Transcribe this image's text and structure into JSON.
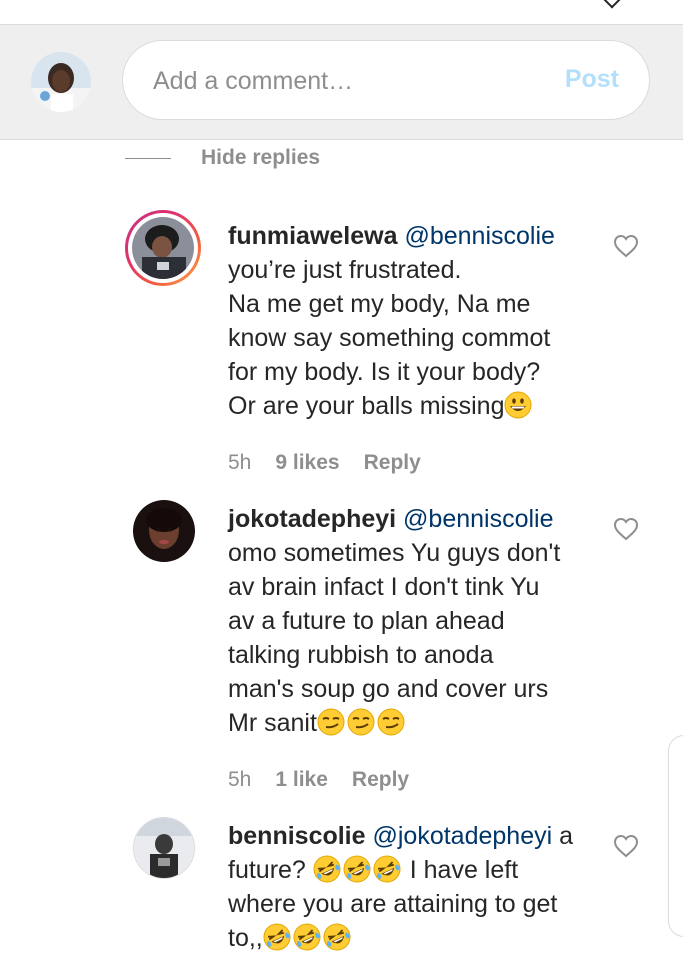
{
  "composer": {
    "placeholder": "Add a comment…",
    "post_label": "Post"
  },
  "thread": {
    "hide_replies_label": "Hide replies"
  },
  "comments": [
    {
      "username": "funmiawelewa",
      "mention": "@benniscolie",
      "lines": [
        "you’re just frustrated.",
        "Na me get my body, Na me",
        "know say something commot",
        "for my body. Is it your body?",
        "Or are your balls missing"
      ],
      "emoji": [
        "grinning-face"
      ],
      "age": "5h",
      "likes": "9 likes",
      "reply_label": "Reply",
      "story_ring": true
    },
    {
      "username": "jokotadepheyi",
      "mention": "@benniscolie",
      "lines": [
        "omo sometimes Yu guys don't",
        "av brain infact I don't tink Yu",
        "av a future to plan ahead",
        "talking rubbish to anoda",
        "man's soup go and cover urs",
        "Mr sanit"
      ],
      "emoji": [
        "smirking-face",
        "smirking-face",
        "smirking-face"
      ],
      "age": "5h",
      "likes": "1 like",
      "reply_label": "Reply",
      "story_ring": false
    },
    {
      "username": "benniscolie",
      "mention": "@jokotadepheyi",
      "mention_tail": "a",
      "lines": [
        "future?",
        "I have left",
        "where you are attaining to get",
        "to,,"
      ],
      "emoji": [
        "rolling-laughing-face",
        "rolling-laughing-face",
        "rolling-laughing-face"
      ],
      "story_ring": false
    }
  ],
  "colors": {
    "composer_bg": "#efefef",
    "post_disabled": "#b2dffc",
    "mention": "#003569",
    "meta_gray": "#8e8e8e",
    "story_ring": [
      "#c13584",
      "#e1306c",
      "#f56040",
      "#fcaf45"
    ]
  }
}
